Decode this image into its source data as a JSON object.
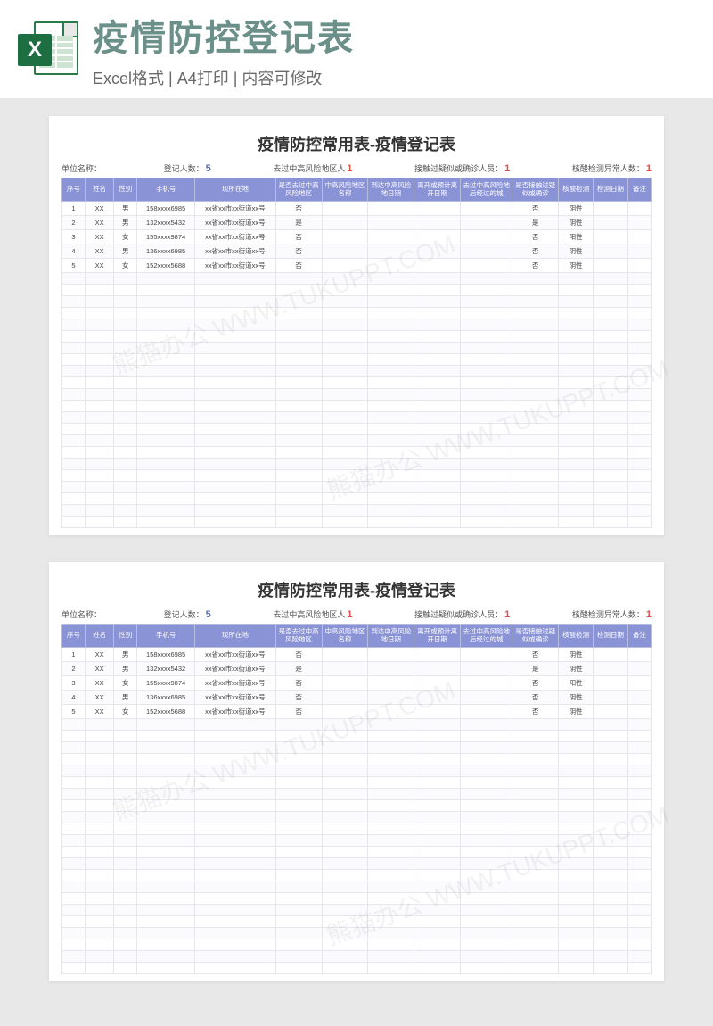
{
  "header": {
    "title": "疫情防控登记表",
    "subtitle": "Excel格式 | A4打印 | 内容可修改",
    "excel_badge": "X"
  },
  "sheet": {
    "title": "疫情防控常用表-疫情登记表",
    "info": {
      "unit_label": "单位名称：",
      "count_label": "登记人数：",
      "count_value": "5",
      "risk_label": "去过中高风险地区人",
      "risk_value": "1",
      "contact_label": "接触过疑似或确诊人员：",
      "contact_value": "1",
      "test_label": "核酸检测异常人数：",
      "test_value": "1"
    },
    "columns": [
      "序号",
      "姓名",
      "性别",
      "手机号",
      "现所在地",
      "是否去过中高风险地区",
      "中高风险地区名称",
      "到达中高风险地日期",
      "离开或预计离开日期",
      "去过中高风险地后经过的城",
      "是否接触过疑似或确诊",
      "核酸检测",
      "检测日期",
      "备注"
    ],
    "col_widths": [
      "4%",
      "5%",
      "4%",
      "10%",
      "14%",
      "8%",
      "8%",
      "8%",
      "8%",
      "9%",
      "8%",
      "6%",
      "6%",
      "4%"
    ],
    "rows": [
      {
        "c": [
          "1",
          "XX",
          "男",
          "158xxxx6985",
          "xx省xx市xx街道xx号",
          "否",
          "",
          "",
          "",
          "",
          "否",
          "阴性",
          "",
          ""
        ]
      },
      {
        "c": [
          "2",
          "XX",
          "男",
          "132xxxx5432",
          "xx省xx市xx街道xx号",
          "是",
          "",
          "",
          "",
          "",
          "是",
          "阴性",
          "",
          ""
        ]
      },
      {
        "c": [
          "3",
          "XX",
          "女",
          "155xxxx9874",
          "xx省xx市xx街道xx号",
          "否",
          "",
          "",
          "",
          "",
          "否",
          "阳性",
          "",
          ""
        ]
      },
      {
        "c": [
          "4",
          "XX",
          "男",
          "136xxxx6985",
          "xx省xx市xx街道xx号",
          "否",
          "",
          "",
          "",
          "",
          "否",
          "阴性",
          "",
          ""
        ]
      },
      {
        "c": [
          "5",
          "XX",
          "女",
          "152xxxx5688",
          "xx省xx市xx街道xx号",
          "否",
          "",
          "",
          "",
          "",
          "否",
          "阴性",
          "",
          ""
        ]
      }
    ],
    "empty_rows": 22
  },
  "watermark_text": "熊猫办公 WWW.TUKUPPT.COM"
}
